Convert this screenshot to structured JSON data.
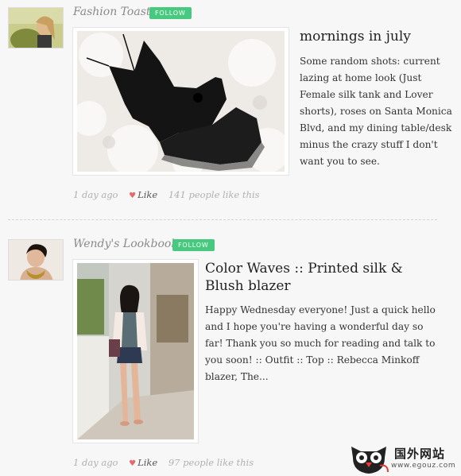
{
  "posts": [
    {
      "blog_name": "Fashion Toast",
      "follow_label": "FOLLOW",
      "title": "mornings in july",
      "body": "Some random shots: current lazing at home look (Just Female silk tank and Lover shorts), roses on Santa Monica Blvd, and my dining table/desk minus the crazy stuff I don't want you to see.",
      "time": "1 day ago",
      "like_label": "Like",
      "like_count": "141 people like this"
    },
    {
      "blog_name": "Wendy's Lookbook",
      "follow_label": "FOLLOW",
      "title": "Color Waves :: Printed silk & Blush blazer",
      "body": "Happy Wednesday everyone! Just a quick hello and I hope you're having a wonderful day so far! Thank you so much for reading and talk to you soon! :: Outfit :: Top :: Rebecca Minkoff blazer, The...",
      "time": "1 day ago",
      "like_label": "Like",
      "like_count": "97 people like this"
    }
  ],
  "watermark": {
    "text": "国外网站",
    "url": "www.egouz.com"
  }
}
